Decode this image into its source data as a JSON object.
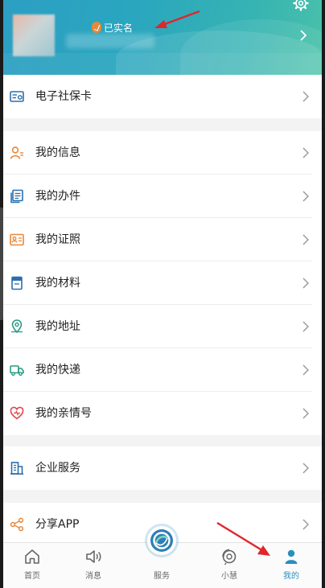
{
  "header": {
    "verified_label": "已实名"
  },
  "sections": [
    {
      "items": [
        {
          "label": "电子社保卡",
          "icon": "social-card-icon"
        }
      ]
    },
    {
      "items": [
        {
          "label": "我的信息",
          "icon": "user-info-icon"
        },
        {
          "label": "我的办件",
          "icon": "documents-icon"
        },
        {
          "label": "我的证照",
          "icon": "license-icon"
        },
        {
          "label": "我的材料",
          "icon": "materials-icon"
        },
        {
          "label": "我的地址",
          "icon": "location-icon"
        },
        {
          "label": "我的快递",
          "icon": "truck-icon"
        },
        {
          "label": "我的亲情号",
          "icon": "heart-icon"
        }
      ]
    },
    {
      "items": [
        {
          "label": "企业服务",
          "icon": "building-icon"
        }
      ]
    },
    {
      "items": [
        {
          "label": "分享APP",
          "icon": "share-icon"
        }
      ]
    }
  ],
  "tabbar": {
    "tabs": [
      {
        "label": "首页",
        "icon": "home-icon"
      },
      {
        "label": "消息",
        "icon": "speaker-icon"
      },
      {
        "label": "服务",
        "icon": "service-logo-icon"
      },
      {
        "label": "小慧",
        "icon": "assistant-icon"
      },
      {
        "label": "我的",
        "icon": "profile-icon",
        "active": true
      }
    ]
  },
  "colors": {
    "accent": "#2a8ebf",
    "banner_start": "#2c9fc3",
    "banner_end": "#49c1a9",
    "annotation_arrow": "#e0262b"
  }
}
